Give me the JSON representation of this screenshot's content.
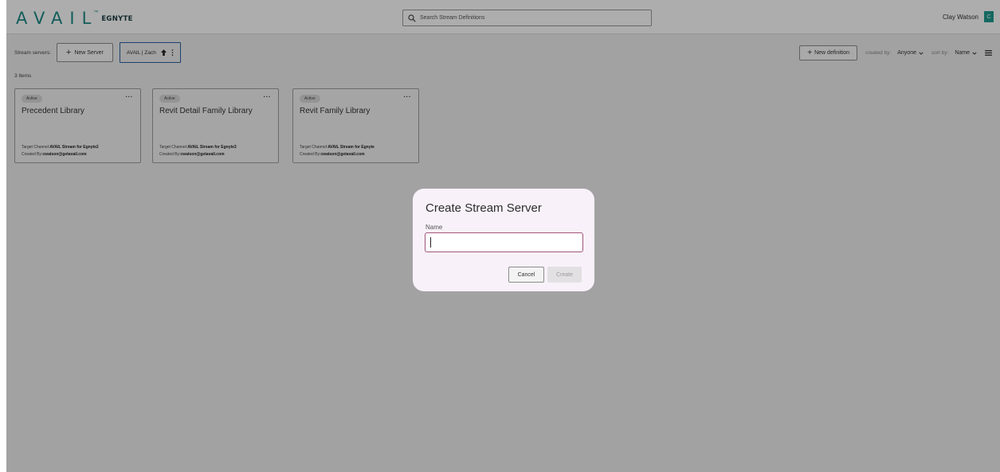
{
  "header": {
    "logo_text": "AVAIL",
    "logo_tm": "™",
    "logo_brand": "EGNYTE",
    "search_placeholder": "Search Stream Definitions",
    "user_name": "Clay Watson",
    "avatar_initial": "C"
  },
  "toolbar": {
    "servers_label": "Stream servers:",
    "new_server_label": "New Server",
    "selected_server": "AVAIL | Zach",
    "new_definition_label": "New definition",
    "created_by_label": "created by:",
    "created_by_value": "Anyone",
    "sort_by_label": "sort by:",
    "sort_by_value": "Name"
  },
  "item_count": "3 Items",
  "cards": [
    {
      "status": "Active",
      "title": "Precedent Library",
      "target_label": "Target Channel:",
      "target_value": "AVAIL Stream for Egnyte2",
      "created_label": "Created By:",
      "created_value": "cwatson@getavail.com"
    },
    {
      "status": "Active",
      "title": "Revit Detail Family Library",
      "target_label": "Target Channel:",
      "target_value": "AVAIL Stream for Egnyte3",
      "created_label": "Created By:",
      "created_value": "cwatson@getavail.com"
    },
    {
      "status": "Active",
      "title": "Revit Family Library",
      "target_label": "Target Channel:",
      "target_value": "AVAIL Stream for Egnyte",
      "created_label": "Created By:",
      "created_value": "cwatson@getavail.com"
    }
  ],
  "dialog": {
    "title": "Create Stream Server",
    "name_label": "Name",
    "name_value": "",
    "cancel_label": "Cancel",
    "create_label": "Create"
  },
  "colors": {
    "brand_teal": "#1e8a86",
    "avatar_bg": "#1e9b8f",
    "input_focus_border": "#a0557a",
    "dialog_bg": "#f8f1fa"
  },
  "icons": [
    "search-icon",
    "plus-icon",
    "upload-icon",
    "kebab-icon",
    "chevron-down-icon",
    "list-view-icon",
    "more-icon"
  ]
}
